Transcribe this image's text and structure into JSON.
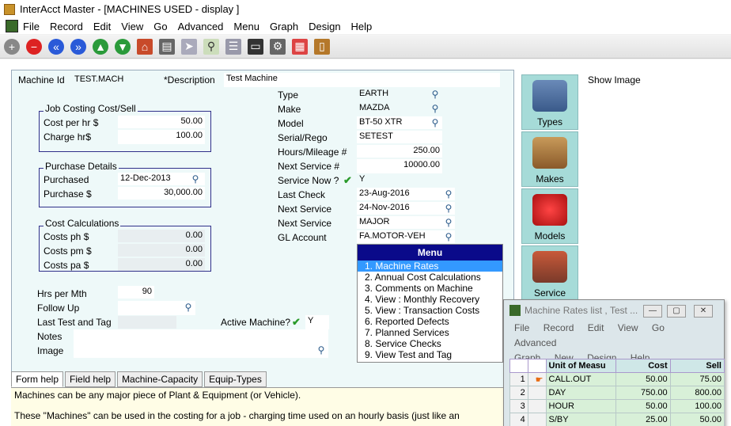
{
  "window": {
    "title": "InterAcct Master - [MACHINES USED - display ]"
  },
  "menubar": [
    "File",
    "Record",
    "Edit",
    "View",
    "Go",
    "Advanced",
    "Menu",
    "Graph",
    "Design",
    "Help"
  ],
  "form": {
    "machine_id_label": "Machine Id",
    "machine_id_value": "TEST.MACH",
    "description_label": "*Description",
    "description_value": "Test Machine",
    "job_costing_title": "Job Costing Cost/Sell",
    "cost_per_hr_label": "Cost per hr $",
    "cost_per_hr_value": "50.00",
    "charge_hr_label": "Charge hr$",
    "charge_hr_value": "100.00",
    "purchase_title": "Purchase Details",
    "purchased_label": "Purchased",
    "purchased_value": "12-Dec-2013",
    "purchase_amt_label": "Purchase $",
    "purchase_amt_value": "30,000.00",
    "cost_calc_title": "Cost Calculations",
    "costs_ph_label": "Costs ph $",
    "costs_ph_value": "0.00",
    "costs_pm_label": "Costs pm $",
    "costs_pm_value": "0.00",
    "costs_pa_label": "Costs pa $",
    "costs_pa_value": "0.00",
    "hrs_per_mth_label": "Hrs per Mth",
    "hrs_per_mth_value": "90",
    "follow_up_label": "Follow Up",
    "last_test_label": "Last Test and Tag",
    "notes_label": "Notes",
    "image_label": "Image",
    "type_label": "Type",
    "type_value": "EARTH",
    "make_label": "Make",
    "make_value": "MAZDA",
    "model_label": "Model",
    "model_value": "BT-50 XTR",
    "serial_label": "Serial/Rego",
    "serial_value": "SETEST",
    "hours_label": "Hours/Mileage #",
    "hours_value": "250.00",
    "next_service_num_label": "Next Service #",
    "next_service_num_value": "10000.00",
    "service_now_label": "Service Now ?",
    "service_now_value": "Y",
    "last_check_label": "Last Check",
    "last_check_value": "23-Aug-2016",
    "next_service_label": "Next Service",
    "next_service_value": "24-Nov-2016",
    "next_service2_label": "Next Service",
    "next_service2_value": "MAJOR",
    "gl_account_label": "GL Account",
    "gl_account_value": "FA.MOTOR-VEH",
    "active_label": "Active Machine?",
    "active_value": "Y"
  },
  "side": {
    "show_image": "Show Image",
    "buttons": [
      "Types",
      "Makes",
      "Models",
      "Service"
    ]
  },
  "popup_menu": {
    "title": "Menu",
    "items": [
      "1. Machine Rates",
      "2. Annual Cost Calculations",
      "3. Comments on Machine",
      "4. View : Monthly Recovery",
      "5. View : Transaction Costs",
      "6. Reported Defects",
      "7. Planned Services",
      "8. Service Checks",
      "9. View Test and Tag"
    ]
  },
  "tabs": [
    "Form help",
    "Field help",
    "Machine-Capacity",
    "Equip-Types"
  ],
  "help": {
    "line1": "Machines can be any major piece of Plant & Equipment (or Vehicle).",
    "line2": "These \"Machines\" can be used in the costing for a job - charging time used on an hourly basis (just like an"
  },
  "subwindow": {
    "title": "Machine Rates list , Test ...",
    "menu_row1": [
      "File",
      "Record",
      "Edit",
      "View",
      "Go",
      "Advanced"
    ],
    "menu_row2": [
      "Graph",
      "New",
      "Design",
      "Help"
    ],
    "columns": [
      "Unit of Measu",
      "Cost",
      "Sell"
    ],
    "rows": [
      {
        "n": "1",
        "unit": "CALL.OUT",
        "cost": "50.00",
        "sell": "75.00"
      },
      {
        "n": "2",
        "unit": "DAY",
        "cost": "750.00",
        "sell": "800.00"
      },
      {
        "n": "3",
        "unit": "HOUR",
        "cost": "50.00",
        "sell": "100.00"
      },
      {
        "n": "4",
        "unit": "S/BY",
        "cost": "25.00",
        "sell": "50.00"
      }
    ]
  }
}
